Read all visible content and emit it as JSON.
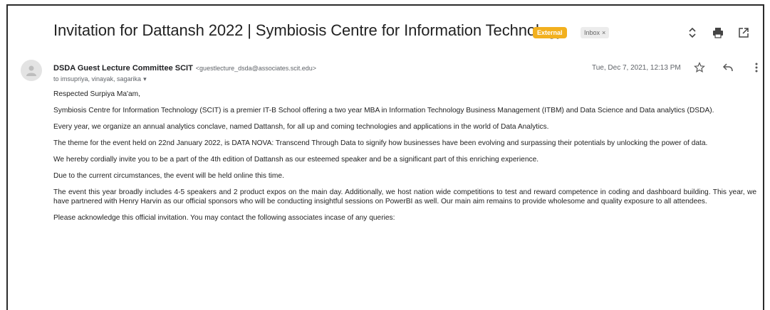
{
  "email": {
    "subject": "Invitation for Dattansh 2022 | Symbiosis Centre for Information Technology",
    "labels": {
      "external": "External",
      "inbox": "Inbox",
      "inbox_remove": "×"
    },
    "sender": {
      "name": "DSDA Guest Lecture Committee SCIT",
      "address": "<guestlecture_dsda@associates.scit.edu>"
    },
    "recipients": "to imsupriya, vinayak, sagarika",
    "date": "Tue, Dec 7, 2021, 12:13 PM",
    "body": [
      "Respected Surpiya Ma'am,",
      "Symbiosis Centre for Information Technology (SCIT) is a premier IT-B School offering a two year MBA in Information Technology Business Management (ITBM) and Data Science and Data analytics (DSDA).",
      "Every year, we organize an annual analytics conclave, named Dattansh, for all up and coming technologies and applications in the world of Data Analytics.",
      "The theme for the event held on 22nd January 2022, is DATA NOVA: Transcend Through Data to signify how businesses have been evolving and surpassing their potentials by unlocking the power of data.",
      "We hereby cordially invite you to be a part of the 4th edition of Dattansh as our esteemed speaker and be a significant part of this enriching experience.",
      "Due to the current circumstances, the event will be held online this time.",
      "The event this year broadly includes 4-5 speakers and 2 product expos on the main day. Additionally, we host nation wide competitions to test and reward competence in coding and dashboard building. This year, we have partnered with Henry Harvin as our official sponsors who will be conducting insightful sessions on PowerBI as well. Our main aim remains to provide wholesome and quality exposure to all attendees.",
      "Please acknowledge this official invitation. You may contact the following associates incase of any queries:"
    ]
  },
  "icons": {
    "expand": "unfold-icon",
    "print": "print-icon",
    "open_new": "open-in-new-window-icon",
    "star": "star-icon",
    "reply": "reply-icon",
    "more": "more-vertical-icon",
    "avatar": "person-icon"
  },
  "colors": {
    "external_badge": "#f2b01e",
    "inbox_badge": "#ececec",
    "frame_border": "#2b2b2b"
  }
}
